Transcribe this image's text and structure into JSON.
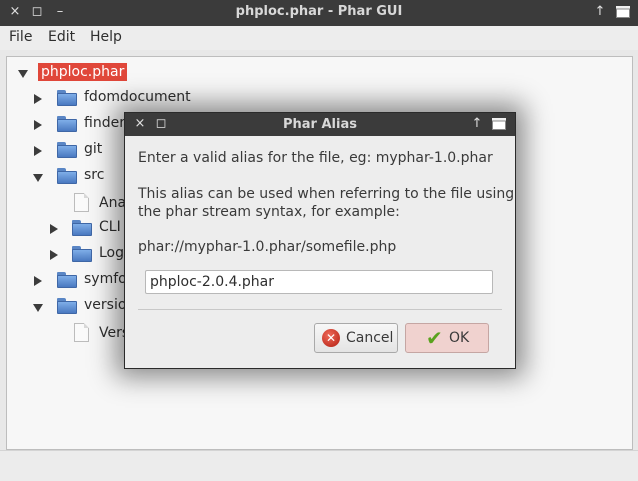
{
  "window": {
    "title": "phploc.phar - Phar GUI",
    "close_glyph": "×",
    "maximize_glyph": "◻",
    "minimize_glyph": "–",
    "up_glyph": "↑"
  },
  "menubar": {
    "items": [
      "File",
      "Edit",
      "Help"
    ]
  },
  "tree": {
    "root": "phploc.phar",
    "items": [
      {
        "label": "fdomdocument",
        "type": "folder",
        "expanded": false
      },
      {
        "label": "finder",
        "type": "folder",
        "expanded": false
      },
      {
        "label": "git",
        "type": "folder",
        "expanded": false
      },
      {
        "label": "src",
        "type": "folder",
        "expanded": true
      },
      {
        "label": "Ana",
        "type": "file"
      },
      {
        "label": "CLI",
        "type": "folder",
        "expanded": false
      },
      {
        "label": "Log",
        "type": "folder",
        "expanded": false
      },
      {
        "label": "symfo",
        "type": "folder",
        "expanded": false
      },
      {
        "label": "versio",
        "type": "folder",
        "expanded": true
      },
      {
        "label": "Vers",
        "type": "file"
      }
    ]
  },
  "dialog": {
    "title": "Phar Alias",
    "prompt": "Enter a valid alias for the file, eg: myphar-1.0.phar",
    "info_line1": "This alias can be used when referring to the file using",
    "info_line2": "the phar stream syntax, for example:",
    "example": "phar://myphar-1.0.phar/somefile.php",
    "input_value": "phploc-2.0.4.phar",
    "cancel_label": "Cancel",
    "ok_label": "OK"
  },
  "colors": {
    "selection": "#e0473a",
    "titlebar": "#3b3b3b",
    "ok_button": "#f0d2cf"
  }
}
